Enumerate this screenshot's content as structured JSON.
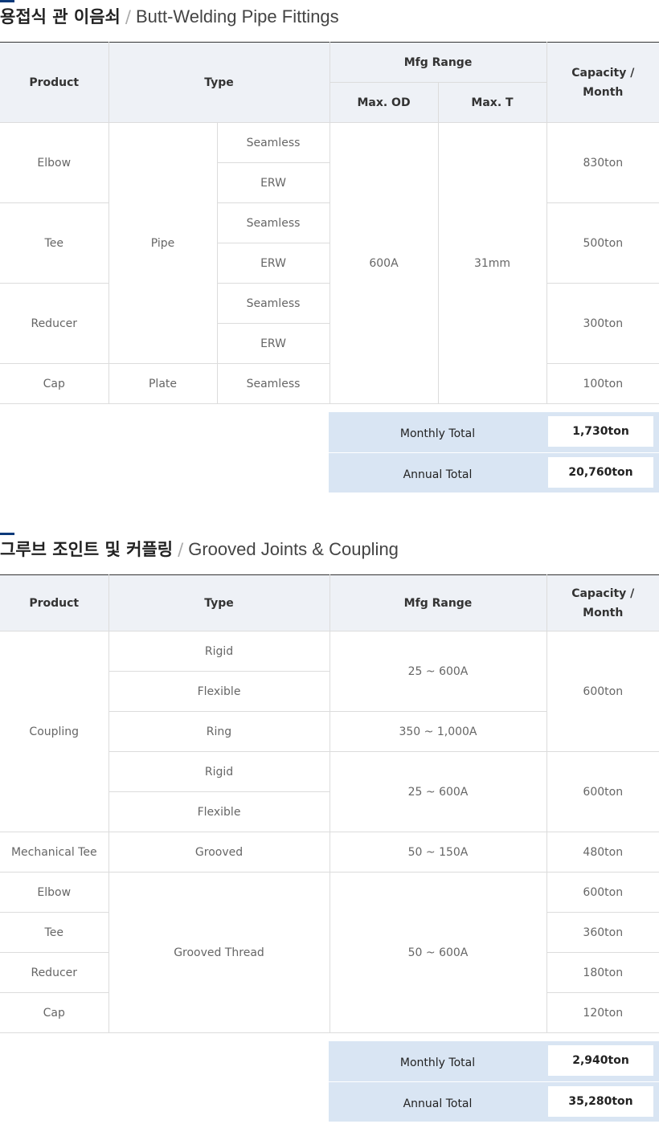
{
  "section1": {
    "title_ko": "용접식 관 이음쇠",
    "title_sep": "/",
    "title_en": "Butt-Welding Pipe Fittings",
    "headers": {
      "product": "Product",
      "type": "Type",
      "mfg_range": "Mfg Range",
      "max_od": "Max. OD",
      "max_t": "Max. T",
      "capacity_line1": "Capacity /",
      "capacity_line2": "Month"
    },
    "rows": {
      "elbow": "Elbow",
      "tee": "Tee",
      "reducer": "Reducer",
      "cap": "Cap",
      "pipe": "Pipe",
      "plate": "Plate",
      "seamless": "Seamless",
      "erw": "ERW",
      "od_value": "600A",
      "t_value": "31mm",
      "elbow_cap": "830ton",
      "tee_cap": "500ton",
      "reducer_cap": "300ton",
      "cap_cap": "100ton"
    },
    "totals": {
      "monthly_label": "Monthly Total",
      "monthly_value": "1,730ton",
      "annual_label": "Annual Total",
      "annual_value": "20,760ton"
    }
  },
  "section2": {
    "title_ko": "그루브 조인트 및 커플링",
    "title_sep": "/",
    "title_en": "Grooved Joints & Coupling",
    "headers": {
      "product": "Product",
      "type": "Type",
      "mfg_range": "Mfg Range",
      "capacity_line1": "Capacity /",
      "capacity_line2": "Month"
    },
    "rows": {
      "coupling": "Coupling",
      "rigid": "Rigid",
      "flexible": "Flexible",
      "ring": "Ring",
      "range_25_600": "25 ~ 600A",
      "range_350_1000": "350 ~ 1,000A",
      "coupling_cap_1": "600ton",
      "coupling_cap_2": "600ton",
      "mech_tee": "Mechanical Tee",
      "grooved": "Grooved",
      "range_50_150": "50 ~ 150A",
      "mech_tee_cap": "480ton",
      "elbow": "Elbow",
      "tee": "Tee",
      "reducer": "Reducer",
      "cap": "Cap",
      "grooved_thread": "Grooved Thread",
      "range_50_600": "50 ~ 600A",
      "elbow_cap": "600ton",
      "tee_cap": "360ton",
      "reducer_cap": "180ton",
      "cap_cap": "120ton"
    },
    "totals": {
      "monthly_label": "Monthly Total",
      "monthly_value": "2,940ton",
      "annual_label": "Annual Total",
      "annual_value": "35,280ton"
    }
  }
}
